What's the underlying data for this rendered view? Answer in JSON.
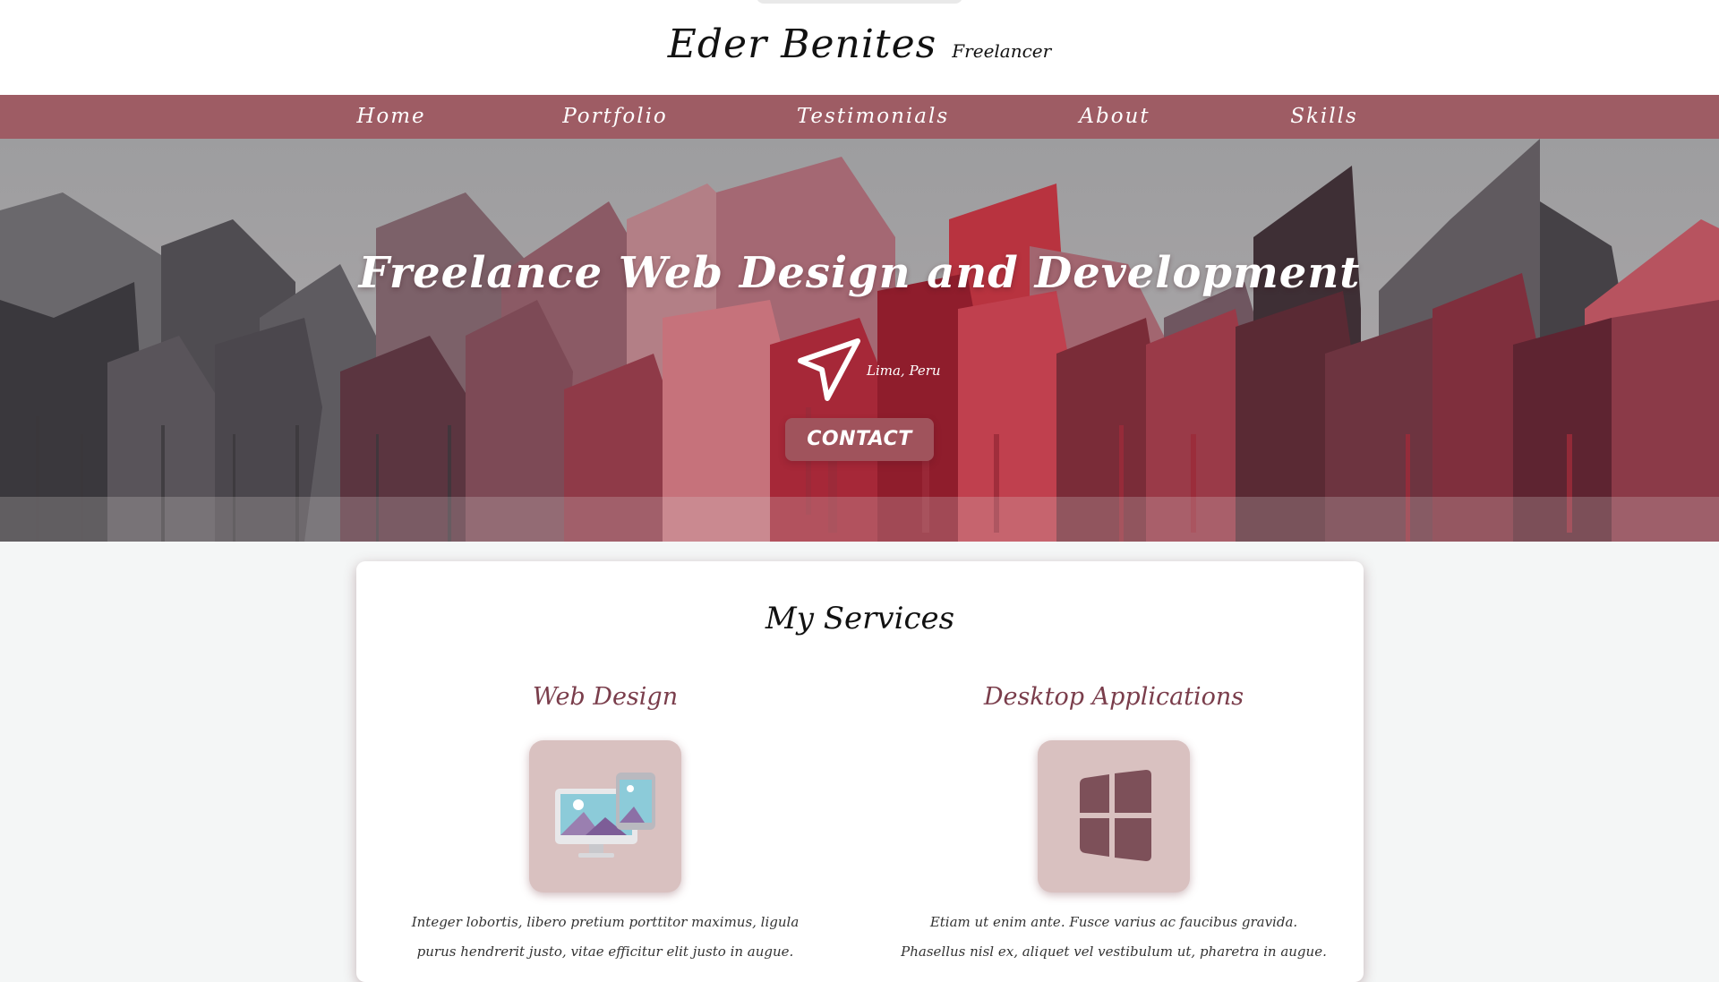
{
  "header": {
    "name": "Eder Benites",
    "role": "Freelancer"
  },
  "nav": {
    "items": [
      {
        "label": "Home"
      },
      {
        "label": "Portfolio"
      },
      {
        "label": "Testimonials"
      },
      {
        "label": "About"
      },
      {
        "label": "Skills"
      }
    ]
  },
  "hero": {
    "title": "Freelance Web Design and Development",
    "location": "Lima, Peru",
    "location_icon": "paper-plane-icon",
    "contact_label": "CONTACT"
  },
  "services": {
    "title": "My Services",
    "items": [
      {
        "title": "Web Design",
        "icon": "devices-icon",
        "description": "Integer lobortis, libero pretium porttitor maximus, ligula purus hendrerit justo, vitae efficitur elit justo in augue."
      },
      {
        "title": "Desktop Applications",
        "icon": "windows-icon",
        "description": "Etiam ut enim ante. Fusce varius ac faucibus gravida. Phasellus nisl ex, aliquet vel vestibulum ut, pharetra in augue."
      }
    ]
  },
  "colors": {
    "nav_bg": "#9e5c64",
    "accent": "#a0535c",
    "service_title": "#7a3d4b",
    "tile_bg": "#d9c1c0"
  }
}
